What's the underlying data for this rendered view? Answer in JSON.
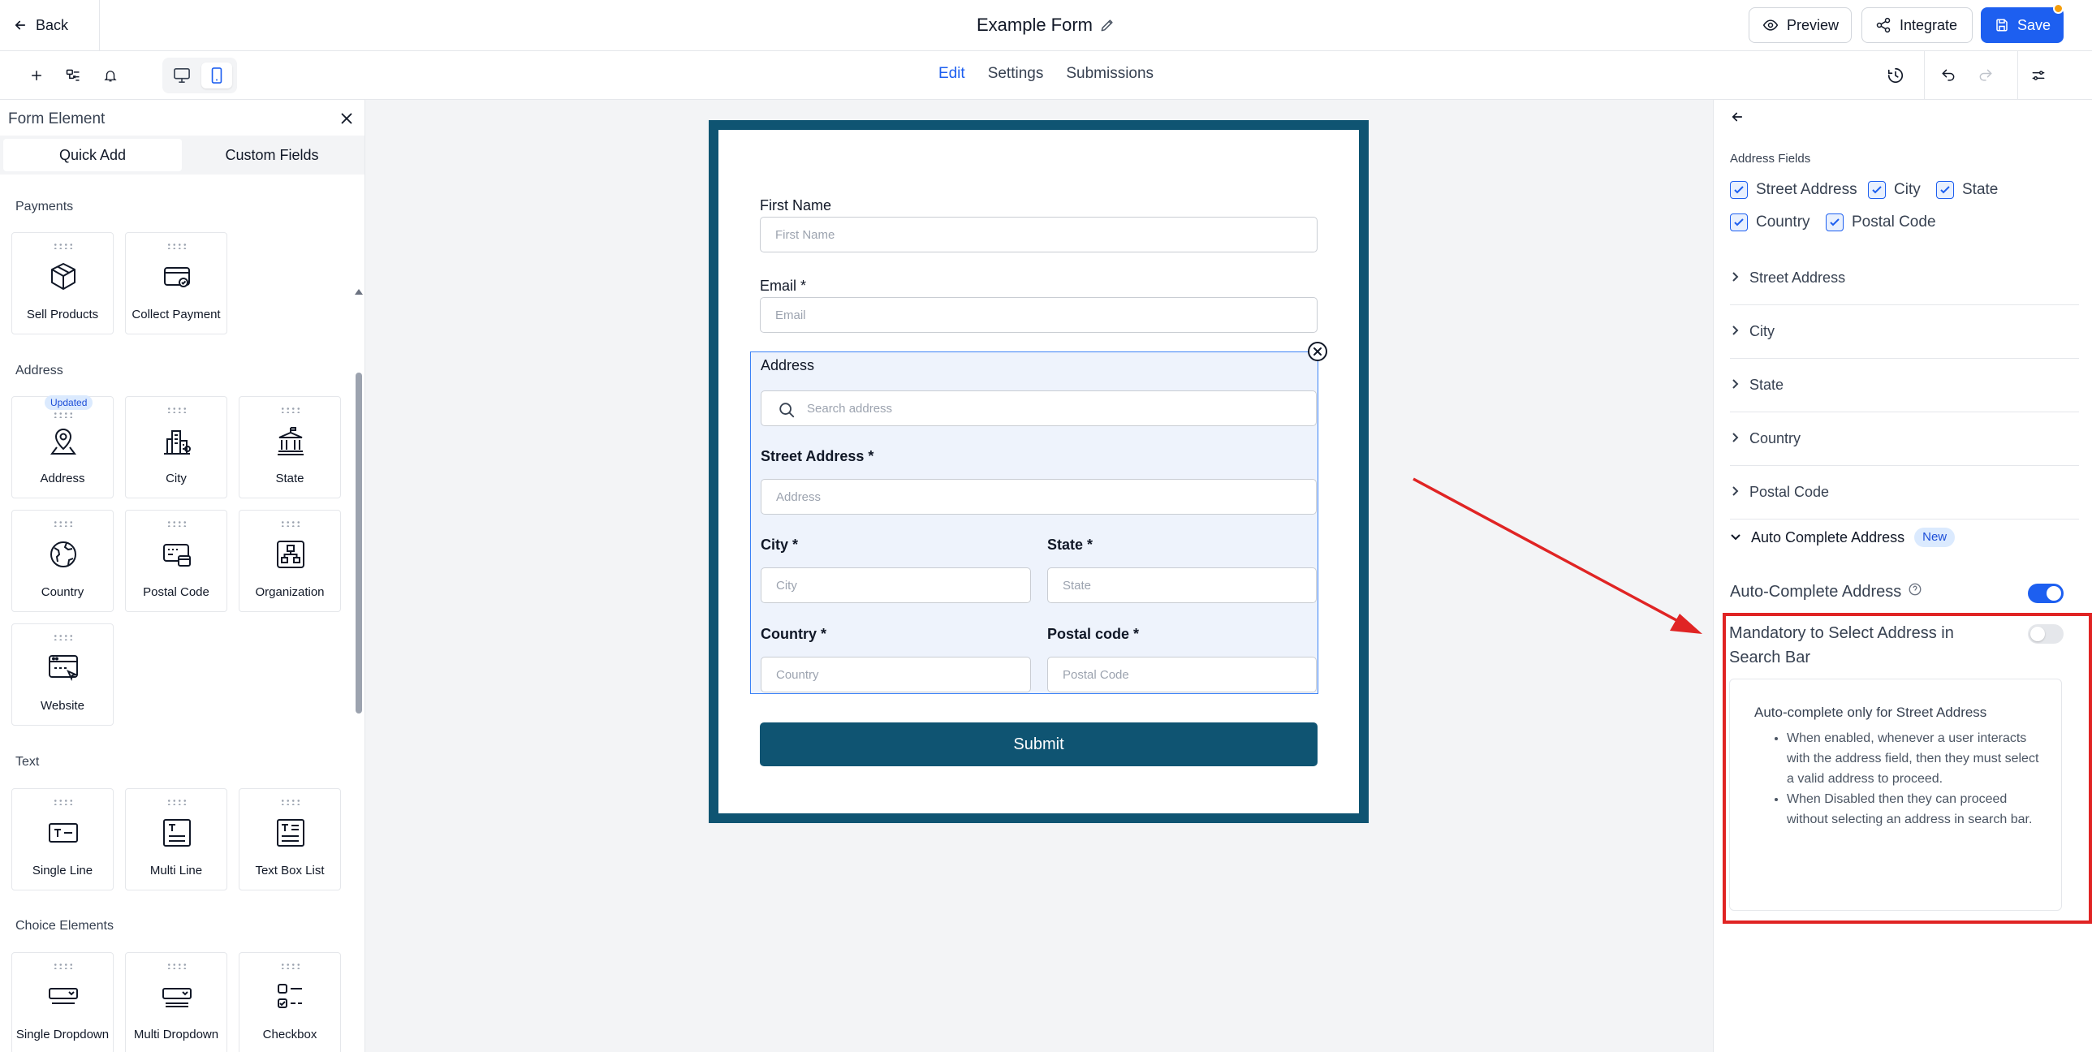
{
  "topbar": {
    "back_label": "Back",
    "form_title": "Example Form",
    "preview_label": "Preview",
    "integrate_label": "Integrate",
    "save_label": "Save"
  },
  "tabs": {
    "edit": "Edit",
    "settings": "Settings",
    "submissions": "Submissions"
  },
  "left_panel": {
    "title": "Form Element",
    "tab_quick_add": "Quick Add",
    "tab_custom_fields": "Custom Fields",
    "sections": {
      "payments": "Payments",
      "address": "Address",
      "text": "Text",
      "choice": "Choice Elements"
    },
    "elements": {
      "sell_products": "Sell Products",
      "collect_payment": "Collect Payment",
      "address": "Address",
      "address_badge": "Updated",
      "city": "City",
      "state": "State",
      "country": "Country",
      "postal_code": "Postal Code",
      "organization": "Organization",
      "website": "Website",
      "single_line": "Single Line",
      "multi_line": "Multi Line",
      "text_box_list": "Text Box List",
      "single_dropdown": "Single Dropdown",
      "multi_dropdown": "Multi Dropdown",
      "checkbox": "Checkbox"
    }
  },
  "form": {
    "first_name_label": "First Name",
    "first_name_placeholder": "First Name",
    "email_label": "Email *",
    "email_placeholder": "Email",
    "address_label": "Address",
    "search_placeholder": "Search address",
    "street_label": "Street Address *",
    "street_placeholder": "Address",
    "city_label": "City *",
    "city_placeholder": "City",
    "state_label": "State *",
    "state_placeholder": "State",
    "country_label": "Country *",
    "country_placeholder": "Country",
    "postal_label": "Postal code *",
    "postal_placeholder": "Postal Code",
    "submit_label": "Submit"
  },
  "right_panel": {
    "address_fields_label": "Address Fields",
    "checks": {
      "street": "Street Address",
      "city": "City",
      "state": "State",
      "country": "Country",
      "postal": "Postal Code"
    },
    "accordions": {
      "street": "Street Address",
      "city": "City",
      "state": "State",
      "country": "Country",
      "postal": "Postal Code"
    },
    "auto_complete_header": "Auto Complete Address",
    "new_badge": "New",
    "auto_complete_label": "Auto-Complete Address",
    "auto_complete_on": true,
    "mandatory_label": "Mandatory to Select Address in Search Bar",
    "mandatory_on": false,
    "info_title": "Auto-complete only for Street Address",
    "info_items": [
      "When enabled, whenever a user interacts with the address field, then they must select a valid address to proceed.",
      "When Disabled then they can proceed without selecting an address in search bar."
    ]
  },
  "colors": {
    "accent": "#1d5ff0",
    "form_border": "#0f5472",
    "highlight": "#e02424"
  }
}
